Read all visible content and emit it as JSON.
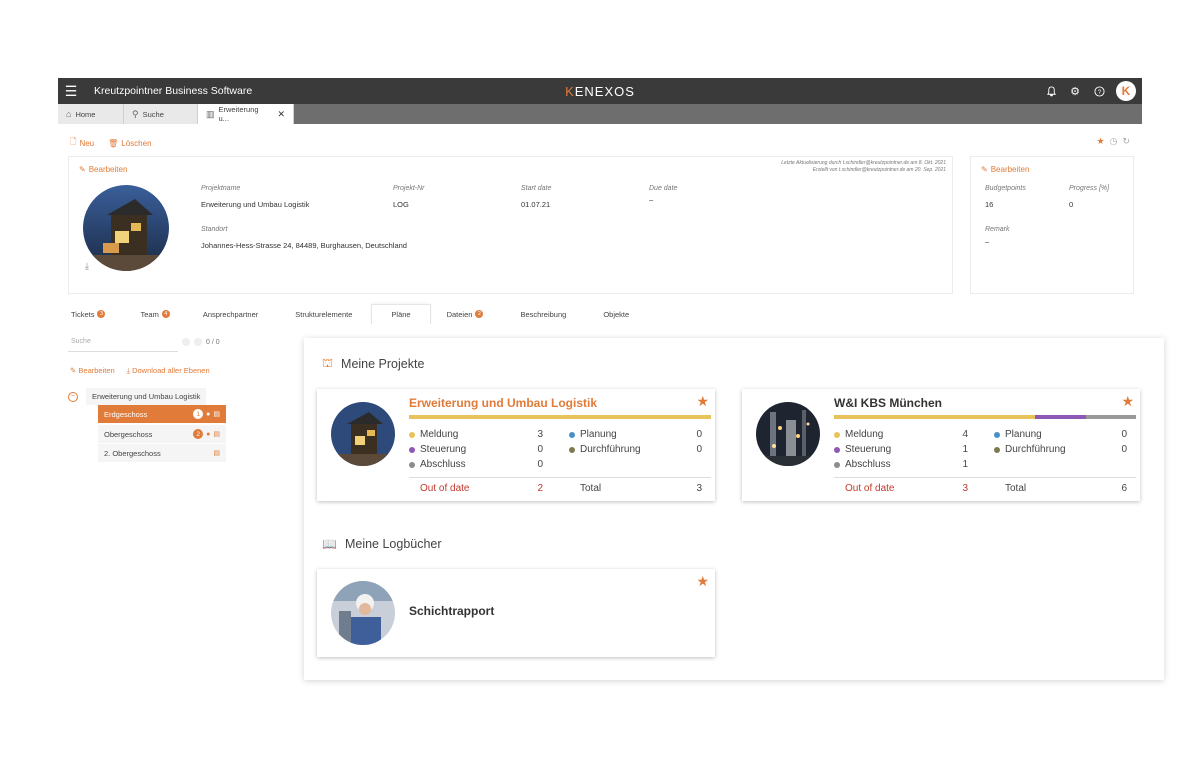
{
  "topbar": {
    "app_title": "Kreutzpointner Business Software",
    "brand_k": "K",
    "brand_rest": "ENEXOS",
    "avatar_letter": "K"
  },
  "tabs": [
    {
      "label": "Home",
      "icon": "home-icon"
    },
    {
      "label": "Suche",
      "icon": "search-icon"
    },
    {
      "label": "Erweiterung u...",
      "icon": "building-icon"
    }
  ],
  "actions": {
    "new": "Neu",
    "delete": "Löschen"
  },
  "detail": {
    "edit": "Bearbeiten",
    "meta_line1": "Letzte Aktualisierung durch t.schindler@kreutzpointner.de am 8. Okt. 2021",
    "meta_line2": "Erstellt von t.schindler@kreutzpointner.de am 20. Sep. 2021",
    "fields": {
      "projektname_label": "Projektname",
      "projektname_value": "Erweiterung und Umbau Logistik",
      "projektnr_label": "Projekt-Nr",
      "projektnr_value": "LOG",
      "start_label": "Start date",
      "start_value": "01.07.21",
      "due_label": "Due date",
      "due_value": "–",
      "standort_label": "Standort",
      "standort_value": "Johannes-Hess-Strasse 24, 84489, Burghausen, Deutschland"
    }
  },
  "side_detail": {
    "edit": "Bearbeiten",
    "budget_label": "Budgetpoints",
    "budget_value": "16",
    "progress_label": "Progress [%]",
    "progress_value": "0",
    "remark_label": "Remark",
    "remark_value": "–"
  },
  "section_tabs": [
    {
      "label": "Tickets",
      "badge": "3"
    },
    {
      "label": "Team",
      "badge": "4"
    },
    {
      "label": "Ansprechpartner",
      "badge": null
    },
    {
      "label": "Strukturelemente",
      "badge": null
    },
    {
      "label": "Pläne",
      "badge": null
    },
    {
      "label": "Dateien",
      "badge": "2"
    },
    {
      "label": "Beschreibung",
      "badge": null
    },
    {
      "label": "Objekte",
      "badge": null
    }
  ],
  "tree": {
    "search_placeholder": "Suche",
    "count": "0 / 0",
    "edit": "Bearbeiten",
    "download": "Download aller Ebenen",
    "root": "Erweiterung und Umbau Logistik",
    "items": [
      {
        "label": "Erdgeschoss",
        "num": "1"
      },
      {
        "label": "Obergeschoss",
        "num": "2"
      },
      {
        "label": "2. Obergeschoss",
        "num": ""
      }
    ]
  },
  "dashboard": {
    "projects_title": "Meine Projekte",
    "logbooks_title": "Meine Logbücher",
    "projects": [
      {
        "title": "Erweiterung und Umbau Logistik",
        "meldung_label": "Meldung",
        "meldung": "3",
        "steuerung_label": "Steuerung",
        "steuerung": "0",
        "abschluss_label": "Abschluss",
        "abschluss": "0",
        "planung_label": "Planung",
        "planung": "0",
        "durchfuehrung_label": "Durchführung",
        "durchfuehrung": "0",
        "ood_label": "Out of date",
        "ood": "2",
        "total_label": "Total",
        "total": "3",
        "bar": [
          {
            "color": "#e8c35a",
            "share": 1.0
          }
        ]
      },
      {
        "title": "W&I KBS München",
        "meldung_label": "Meldung",
        "meldung": "4",
        "steuerung_label": "Steuerung",
        "steuerung": "1",
        "abschluss_label": "Abschluss",
        "abschluss": "1",
        "planung_label": "Planung",
        "planung": "0",
        "durchfuehrung_label": "Durchführung",
        "durchfuehrung": "0",
        "ood_label": "Out of date",
        "ood": "3",
        "total_label": "Total",
        "total": "6",
        "bar": [
          {
            "color": "#e8c35a",
            "share": 0.667
          },
          {
            "color": "#8e58b6",
            "share": 0.167
          },
          {
            "color": "#999999",
            "share": 0.166
          }
        ]
      }
    ],
    "logbook": {
      "title": "Schichtrapport"
    }
  },
  "colors": {
    "accent": "#e07b39",
    "meldung": "#e8c35a",
    "steuerung": "#8e58b6",
    "abschluss": "#8c8c8c",
    "planung": "#4a90c8",
    "durchfuehrung": "#7d7a4e"
  }
}
